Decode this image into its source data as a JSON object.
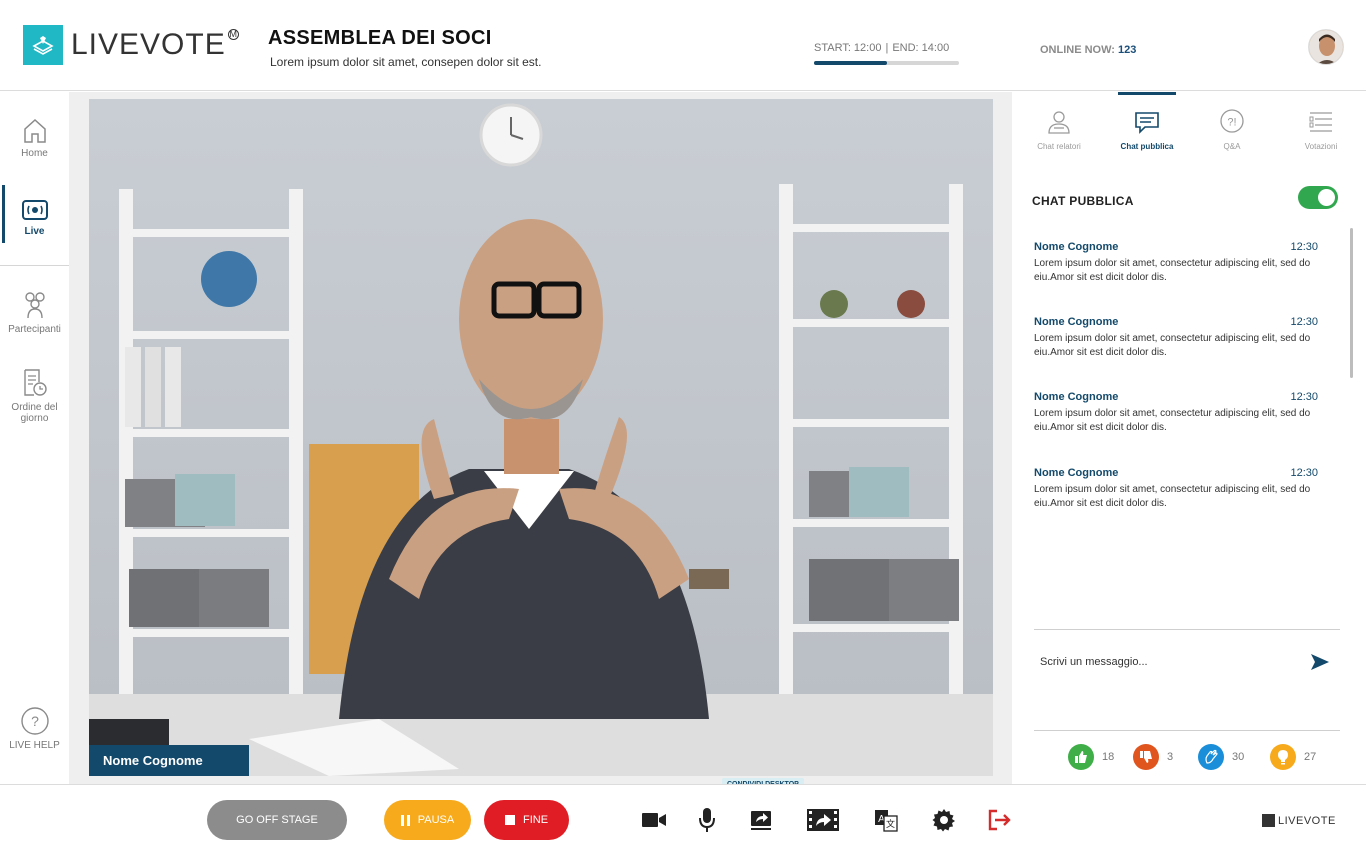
{
  "header": {
    "logo_text": "LIVEVOTE",
    "logo_mark": "M",
    "title": "ASSEMBLEA DEI SOCI",
    "subtitle": "Lorem ipsum dolor sit amet, consepen dolor sit est.",
    "start": "START: 12:00",
    "end": "END: 14:00",
    "session_progress": 0.5,
    "online_label": "ONLINE NOW:",
    "online_count": "123"
  },
  "sidebar": {
    "items": [
      {
        "label": "Home",
        "icon": "home-icon"
      },
      {
        "label": "Live",
        "icon": "live-camera-icon",
        "active": true
      },
      {
        "label": "Partecipanti",
        "icon": "participants-icon"
      },
      {
        "label": "Ordine del giorno",
        "icon": "agenda-icon"
      }
    ],
    "help_label": "LIVE HELP"
  },
  "stage": {
    "speaker_name": "Nome Cognome",
    "tooltip": "CONDIVIDI DESKTOP"
  },
  "panel": {
    "tabs": [
      {
        "label": "Chat relatori",
        "icon": "speaker-chat-icon"
      },
      {
        "label": "Chat pubblica",
        "icon": "public-chat-icon",
        "active": true
      },
      {
        "label": "Q&A",
        "icon": "qa-icon"
      },
      {
        "label": "Votazioni",
        "icon": "votes-icon"
      }
    ],
    "chat_title": "CHAT PUBBLICA",
    "chat_enabled": true,
    "messages": [
      {
        "name": "Nome Cognome",
        "time": "12:30",
        "text": "Lorem ipsum dolor sit amet, consectetur adipiscing elit, sed do eiu.Amor sit est dicit dolor dis."
      },
      {
        "name": "Nome Cognome",
        "time": "12:30",
        "text": "Lorem ipsum dolor sit amet, consectetur adipiscing elit, sed do eiu.Amor sit est dicit dolor dis."
      },
      {
        "name": "Nome Cognome",
        "time": "12:30",
        "text": "Lorem ipsum dolor sit amet, consectetur adipiscing elit, sed do eiu.Amor sit est dicit dolor dis."
      },
      {
        "name": "Nome Cognome",
        "time": "12:30",
        "text": "Lorem ipsum dolor sit amet, consectetur adipiscing elit, sed do eiu.Amor sit est dicit dolor dis."
      }
    ],
    "input_placeholder": "Scrivi un messaggio...",
    "reactions": [
      {
        "icon": "thumbs-up-icon",
        "count": "18",
        "color": "#3fae49"
      },
      {
        "icon": "thumbs-down-icon",
        "count": "3",
        "color": "#e0541e"
      },
      {
        "icon": "clap-icon",
        "count": "30",
        "color": "#1a8ed8"
      },
      {
        "icon": "lightbulb-icon",
        "count": "27",
        "color": "#f6aa1c"
      }
    ]
  },
  "bottombar": {
    "go_off_stage": "GO OFF STAGE",
    "pausa": "PAUSA",
    "fine": "FINE",
    "tools": [
      "camera-icon",
      "microphone-icon",
      "share-screen-icon",
      "share-video-icon",
      "translate-icon",
      "settings-icon",
      "exit-icon"
    ],
    "footer_logo": "LIVEVOTE"
  },
  "colors": {
    "primary": "#13496b",
    "accent": "#1fb8c4",
    "toggle_on": "#31a84f",
    "pause": "#f6aa1c",
    "stop": "#e01d24",
    "exit": "#d62b2b"
  }
}
